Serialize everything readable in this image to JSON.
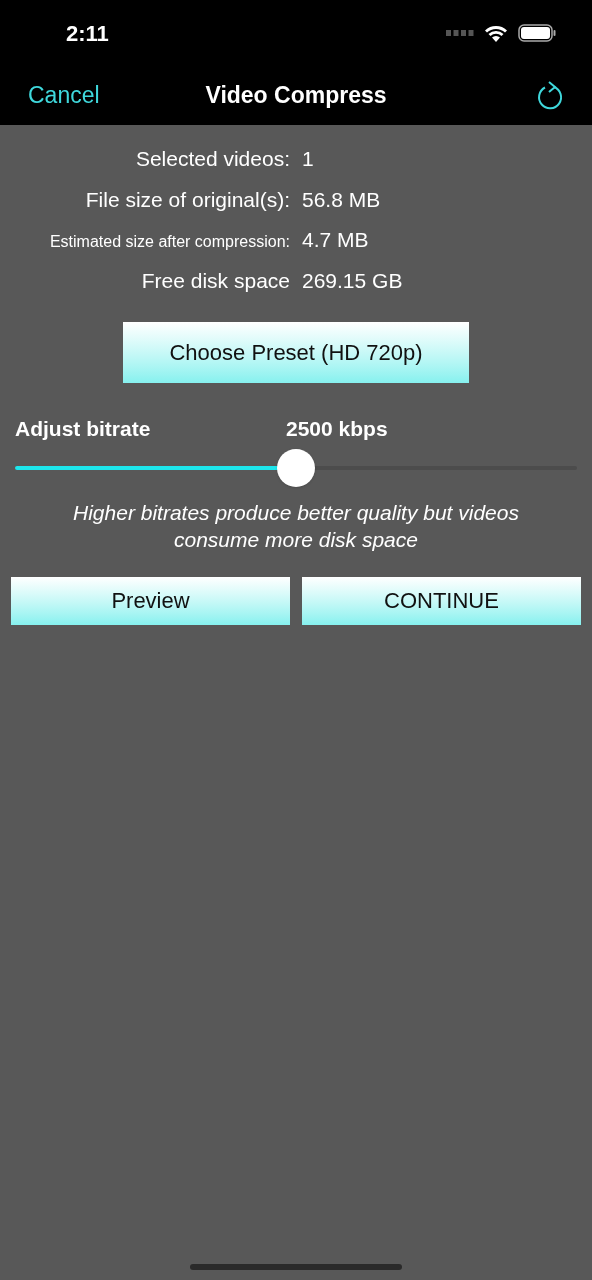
{
  "status_bar": {
    "time": "2:11"
  },
  "nav": {
    "cancel": "Cancel",
    "title": "Video Compress"
  },
  "info": [
    {
      "kind": "normal",
      "label": "Selected videos:",
      "value": "1"
    },
    {
      "kind": "normal",
      "label": "File size of original(s):",
      "value": "56.8 MB"
    },
    {
      "kind": "compact",
      "label": "Estimated size after compression:",
      "value": "4.7 MB"
    },
    {
      "kind": "normal",
      "label": "Free disk space",
      "value": "269.15 GB"
    }
  ],
  "preset_button": "Choose Preset (HD 720p)",
  "bitrate": {
    "label": "Adjust bitrate",
    "reading": "2500 kbps",
    "level": 0.5
  },
  "hint": "Higher bitrates produce better quality but videos consume more disk space",
  "buttons": [
    "Preview",
    "CONTINUE"
  ]
}
